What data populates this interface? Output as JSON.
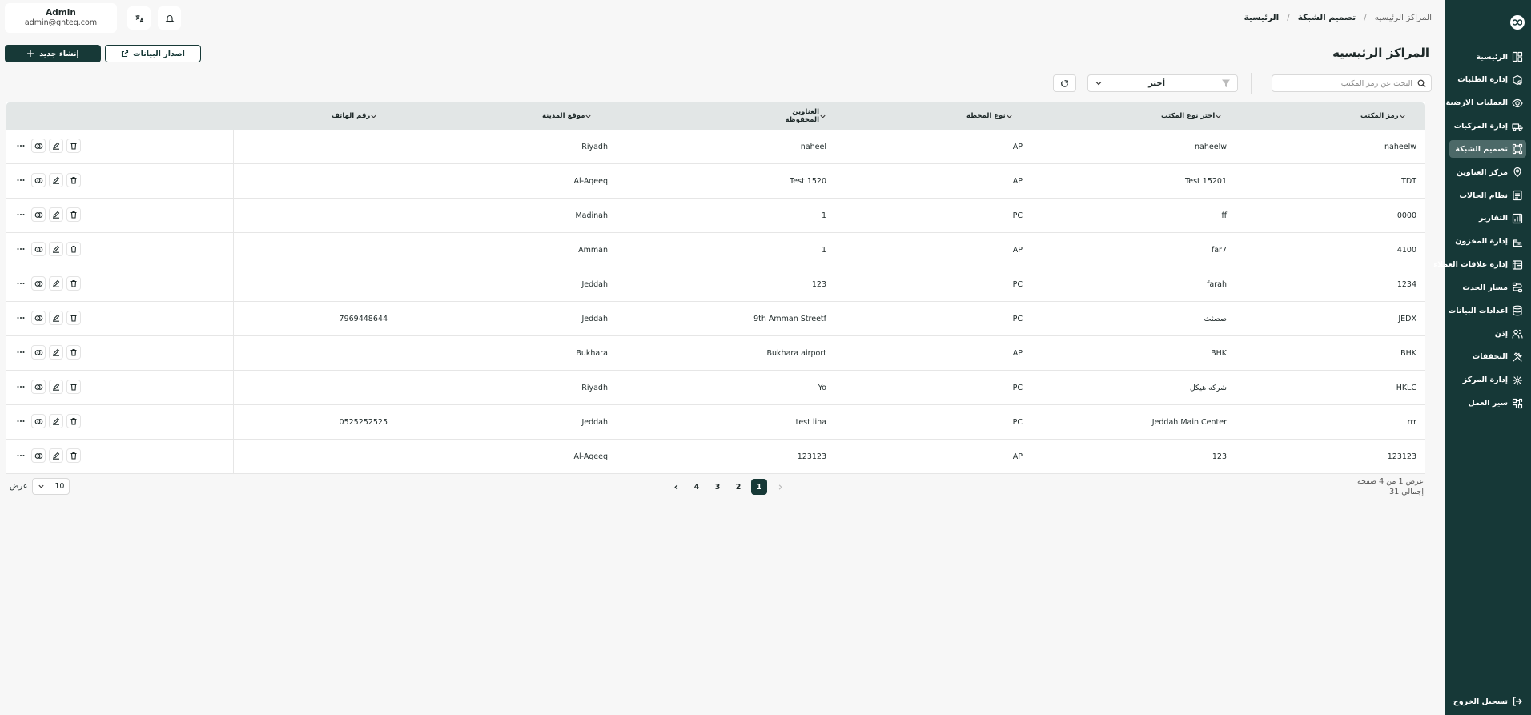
{
  "sidebar": {
    "items": [
      {
        "label": "الرئيسية",
        "icon": "dashboard-icon",
        "active": false
      },
      {
        "label": "إدارة الطلبات",
        "icon": "orders-icon",
        "active": false
      },
      {
        "label": "العمليات الارضية",
        "icon": "ground-ops-icon",
        "active": false
      },
      {
        "label": "إدارة المركبات",
        "icon": "truck-icon",
        "active": false
      },
      {
        "label": "تصميم الشبكة",
        "icon": "network-icon",
        "active": true
      },
      {
        "label": "مركز العناوين",
        "icon": "location-icon",
        "active": false
      },
      {
        "label": "نظام الحالات",
        "icon": "status-icon",
        "active": false
      },
      {
        "label": "التقارير",
        "icon": "reports-icon",
        "active": false
      },
      {
        "label": "إدارة المخزون",
        "icon": "inventory-icon",
        "active": false
      },
      {
        "label": "إدارة علاقات العملاء",
        "icon": "crm-icon",
        "active": false
      },
      {
        "label": "مسار الحدث",
        "icon": "event-path-icon",
        "active": false
      },
      {
        "label": "اعدادات البيانات",
        "icon": "database-icon",
        "active": false
      },
      {
        "label": "إذن",
        "icon": "users-icon",
        "active": false
      },
      {
        "label": "التحققات",
        "icon": "tools-icon",
        "active": false
      },
      {
        "label": "إدارة المركز",
        "icon": "center-settings-icon",
        "active": false
      },
      {
        "label": "سير العمل",
        "icon": "workflow-icon",
        "active": false
      }
    ],
    "logout_label": "تسجيل الخروج"
  },
  "topbar": {
    "breadcrumb": [
      "الرئيسية",
      "تصميم الشبكة",
      "المراكز الرئيسيه"
    ],
    "user_name": "Admin",
    "user_email": "admin@gnteq.com"
  },
  "page": {
    "title": "المراكز الرئيسيه",
    "create_label": "إنشاء جديد",
    "export_label": "اصدار البيانات"
  },
  "filters": {
    "search_placeholder": "البحث عن رمز المكتب",
    "select_value": "أختر"
  },
  "table": {
    "columns": [
      "رمز المكتب",
      "اختر نوع المكتب",
      "نوع المحطة",
      "العناوين المحفوظة",
      "موقع المدينة",
      "رقم الهاتف"
    ],
    "rows": [
      {
        "code": "naheelw",
        "type": "naheelw",
        "station": "AP",
        "address": "naheel",
        "city": "Riyadh",
        "phone": ""
      },
      {
        "code": "TDT",
        "type": "Test 15201",
        "station": "AP",
        "address": "Test 1520",
        "city": "Al-Aqeeq",
        "phone": ""
      },
      {
        "code": "0000",
        "type": "ff",
        "station": "PC",
        "address": "1",
        "city": "Madinah",
        "phone": ""
      },
      {
        "code": "4100",
        "type": "far7",
        "station": "AP",
        "address": "1",
        "city": "Amman",
        "phone": ""
      },
      {
        "code": "1234",
        "type": "farah",
        "station": "PC",
        "address": "123",
        "city": "Jeddah",
        "phone": ""
      },
      {
        "code": "JEDX",
        "type": "صصثث",
        "station": "PC",
        "address": "9th Amman Streetf",
        "city": "Jeddah",
        "phone": "7969448644"
      },
      {
        "code": "BHK",
        "type": "BHK",
        "station": "AP",
        "address": "Bukhara airport",
        "city": "Bukhara",
        "phone": ""
      },
      {
        "code": "HKLC",
        "type": "شركه هيكل",
        "station": "PC",
        "address": "Yo",
        "city": "Riyadh",
        "phone": ""
      },
      {
        "code": "rrr",
        "type": "Jeddah Main Center",
        "station": "PC",
        "address": "test lina",
        "city": "Jeddah",
        "phone": "0525252525"
      },
      {
        "code": "123123",
        "type": "123",
        "station": "AP",
        "address": "123123",
        "city": "Al-Aqeeq",
        "phone": ""
      }
    ]
  },
  "pagination": {
    "info_line1": "عرض 1 من 4 صفحة",
    "info_line2": "إجمالي 31",
    "pages": [
      "1",
      "2",
      "3",
      "4"
    ],
    "current": "1",
    "per_page_label": "عرض",
    "per_page_value": "10"
  },
  "colors": {
    "sidebar_bg": "#163837",
    "accent": "#173937",
    "active_item": "#4c6968"
  }
}
